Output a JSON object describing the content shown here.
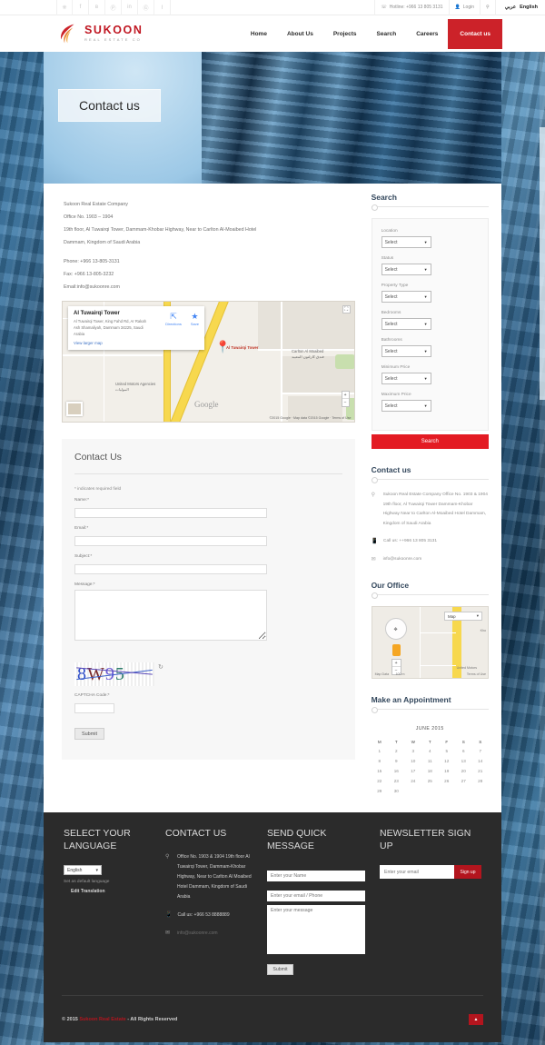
{
  "topbar": {
    "social": [
      {
        "name": "twitter-icon",
        "glyph": "❈"
      },
      {
        "name": "facebook-icon",
        "glyph": "f"
      },
      {
        "name": "behance-icon",
        "glyph": "ʙ"
      },
      {
        "name": "pinterest-icon",
        "glyph": "Ⓟ"
      },
      {
        "name": "linkedin-icon",
        "glyph": "in"
      },
      {
        "name": "googleplus-icon",
        "glyph": "Ⓖ"
      },
      {
        "name": "rss-icon",
        "glyph": "⌇"
      }
    ],
    "hotline": "Hotline: +966 13 805 3131",
    "login": "Login",
    "language_ar": "عربي",
    "language_en": "English"
  },
  "header": {
    "logo_name": "SUKOON",
    "logo_sub": "REAL ESTATE CO",
    "nav": [
      {
        "label": "Home",
        "active": false
      },
      {
        "label": "About Us",
        "active": false
      },
      {
        "label": "Projects",
        "active": false
      },
      {
        "label": "Search",
        "active": false
      },
      {
        "label": "Careers",
        "active": false
      },
      {
        "label": "Contact us",
        "active": true
      }
    ]
  },
  "hero": {
    "title": "Contact us"
  },
  "address": {
    "line1": "Sukoon Real Estate Company",
    "line2": "Office No. 1903 – 1904",
    "line3": "19th floor, Al Tuwairqi Tower, Dammam-Khobar Highway, Near to Carlton Al-Moaibed Hotel",
    "line4": "Dammam, Kingdom of Saudi Arabia",
    "phone": "Phone: +966 13-805-3131",
    "fax": "Fax: +966 13-805-3232",
    "email": "Email:info@sukoonre.com"
  },
  "map": {
    "title": "Al Tuwairqi Tower",
    "detail": "Al Tuwairqi Tower, King Fahd Rd, Ar Rakah Ash Shamaliyah, Dammam 34225, Saudi Arabia",
    "view_larger": "View larger map",
    "directions": "Directions",
    "save": "Save",
    "pin_label": "Al Tuwairqi Tower",
    "poi1": "Carlton Al Moaibed",
    "poi1_ar": "فندق كارلتون المعيبد",
    "poi2": "United Motors Agencies",
    "poi2_ar": "الموليات",
    "watermark": "Google",
    "attribution": "©2015 Google · Map data ©2015 Google · Terms of Use",
    "zoom_in": "+",
    "zoom_out": "−"
  },
  "form": {
    "heading": "Contact Us",
    "required_note": "* indicates required field",
    "name_label": "Name:*",
    "email_label": "Email:*",
    "subject_label": "Subject:*",
    "message_label": "Message:*",
    "name_value": "",
    "email_value": "",
    "subject_value": "",
    "message_value": "",
    "captcha_text": "8W95",
    "captcha_label": "CAPTCHA Code:*",
    "captcha_value": "",
    "submit": "Submit"
  },
  "sidebar": {
    "search": {
      "title": "Search",
      "fields": [
        {
          "label": "Location",
          "value": "Select"
        },
        {
          "label": "Status",
          "value": "Select"
        },
        {
          "label": "Property Type",
          "value": "Select"
        },
        {
          "label": "Bedrooms",
          "value": "Select"
        },
        {
          "label": "Bathrooms",
          "value": "Select"
        },
        {
          "label": "Minimum Price",
          "value": "Select"
        },
        {
          "label": "Maximum Price",
          "value": "Select"
        }
      ],
      "button": "Search"
    },
    "contact": {
      "title": "Contact us",
      "address": "Sukoon Real Estate Company Office No. 1903 & 1904 19th floor, Al Tuwairqi Tower Dammam-Khobar Highway Near to Carlton Al-Moaibed Hotel Dammam, Kingdom of Saudi Arabia",
      "phone": "Call us: ++966 13 805 3131",
      "email": "info@sukoonre.com"
    },
    "office": {
      "title": "Our Office",
      "maptype": "Map",
      "map_data": "Map Data",
      "scale": "100 m",
      "terms": "Terms of Use",
      "poi": "United Motors",
      "road": "Kho",
      "zoom_in": "+",
      "zoom_out": "−"
    },
    "appointment": {
      "title": "Make an Appointment",
      "month": "JUNE 2015",
      "weekdays": [
        "M",
        "T",
        "W",
        "T",
        "F",
        "S",
        "S"
      ],
      "weeks": [
        [
          "1",
          "2",
          "3",
          "4",
          "5",
          "6",
          "7"
        ],
        [
          "8",
          "9",
          "10",
          "11",
          "12",
          "13",
          "14"
        ],
        [
          "15",
          "16",
          "17",
          "18",
          "19",
          "20",
          "21"
        ],
        [
          "22",
          "23",
          "24",
          "25",
          "26",
          "27",
          "28"
        ],
        [
          "29",
          "30",
          "",
          "",
          "",
          "",
          ""
        ]
      ]
    }
  },
  "footer": {
    "lang": {
      "title": "SELECT YOUR LANGUAGE",
      "selected": "English",
      "set_default": "Set as default language",
      "edit": "Edit Translation"
    },
    "contact": {
      "title": "CONTACT US",
      "address": "Office No. 1903 & 1904 19th floor Al Tuwairqi Tower, Dammam-Khobar Highway, Near to Carlton Al Moaibed Hotel Dammam, Kingdom of Saudi Arabia",
      "phone": "Call us: +966 53 8888889",
      "email": "info@sukoonre.com"
    },
    "quick": {
      "title": "SEND QUICK MESSAGE",
      "name_placeholder": "Enter your Name",
      "email_placeholder": "Enter your email / Phone",
      "message_placeholder": "Enter your message",
      "submit": "Submit"
    },
    "newsletter": {
      "title": "NEWSLETTER SIGN UP",
      "placeholder": "Enter your email",
      "button": "Sign up"
    },
    "copyright_year": "© 2015",
    "copyright_brand": "Sukoon Real Estate",
    "copyright_rest": "- All Rights Reserved",
    "to_top": "▲"
  },
  "colors": {
    "brand_red": "#cc2229",
    "search_red": "#e31b23",
    "footer_bg": "#2b2b2b"
  }
}
